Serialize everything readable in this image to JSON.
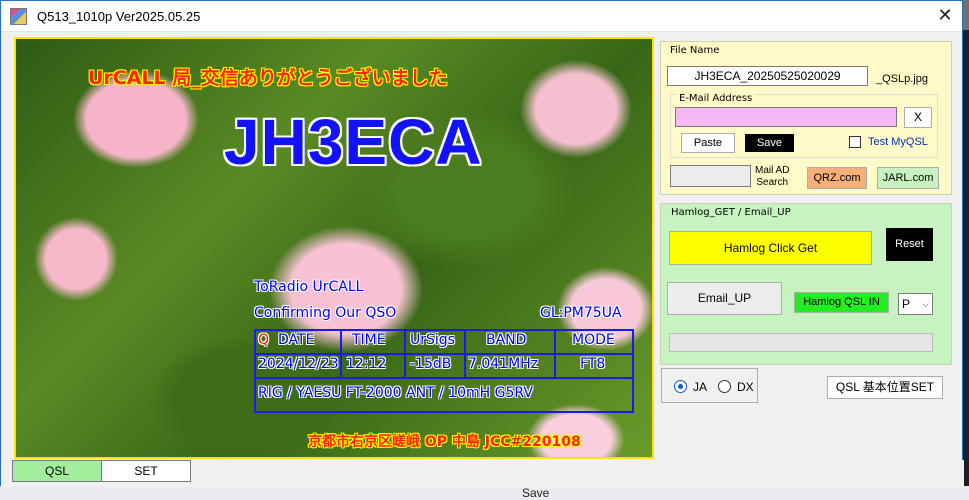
{
  "window": {
    "title": "Q513_1010p   Ver2025.05.25",
    "close_glyph": "✕"
  },
  "background": {
    "bottom_text": "Save"
  },
  "card": {
    "greeting": "UrCALL  局_交信ありがとうございました",
    "callsign": "JH3ECA",
    "to_radio": "ToRadio  UrCALL",
    "confirming": "Confirming Our QSO",
    "grid": "GL:PM75UA",
    "headers": {
      "q": "Q",
      "date": "DATE",
      "time": "TIME",
      "ursigs": "UrSigs",
      "band": "BAND",
      "mode": "MODE"
    },
    "row": {
      "date": "2024/12/23",
      "time": "12:12",
      "ursigs": "-15dB",
      "band": "7.041MHz",
      "mode": "FT8"
    },
    "rig_line": "RIG / YAESU  FT-2000   ANT / 10mH G5RV",
    "address": "京都市右京区嵯峨   OP 中島   JCC#220108"
  },
  "file_panel": {
    "legend": "File Name",
    "file_name": "JH3ECA_20250525020029",
    "file_suffix": "_QSLp.jpg",
    "email_legend": "E-Mail Address",
    "email_value": "",
    "clear_label": "X",
    "paste_label": "Paste",
    "save_label": "Save",
    "test_myqsl_label": "Test MyQSL",
    "test_myqsl_checked": false,
    "mail_ad_value": "",
    "mail_ad_search_label": "Mail AD\nSearch",
    "qrz_label": "QRZ.com",
    "jarl_label": "JARL.com"
  },
  "hamlog_panel": {
    "legend": "Hamlog_GET / Email_UP",
    "click_get_label": "Hamlog Click Get",
    "reset_label": "Reset",
    "email_up_label": "Email_UP",
    "qsl_in_label": "Hamlog QSL IN",
    "select_value": "P",
    "progress_value": 0
  },
  "region": {
    "ja_label": "JA",
    "dx_label": "DX",
    "selected": "JA",
    "basic_pos_label": "QSL 基本位置SET"
  },
  "tabs": [
    {
      "label": "QSL",
      "active": true
    },
    {
      "label": "SET",
      "active": false
    }
  ],
  "colors": {
    "file_panel_bg": "#fffac8",
    "hamlog_panel_bg": "#c7f3c0",
    "email_field_bg": "#f5b8f5",
    "click_get_bg": "#ffff00",
    "qsl_in_bg": "#22ee22",
    "qrz_bg": "#f5b07a",
    "jarl_bg": "#c9f2c0",
    "callsign": "#1212ff"
  }
}
